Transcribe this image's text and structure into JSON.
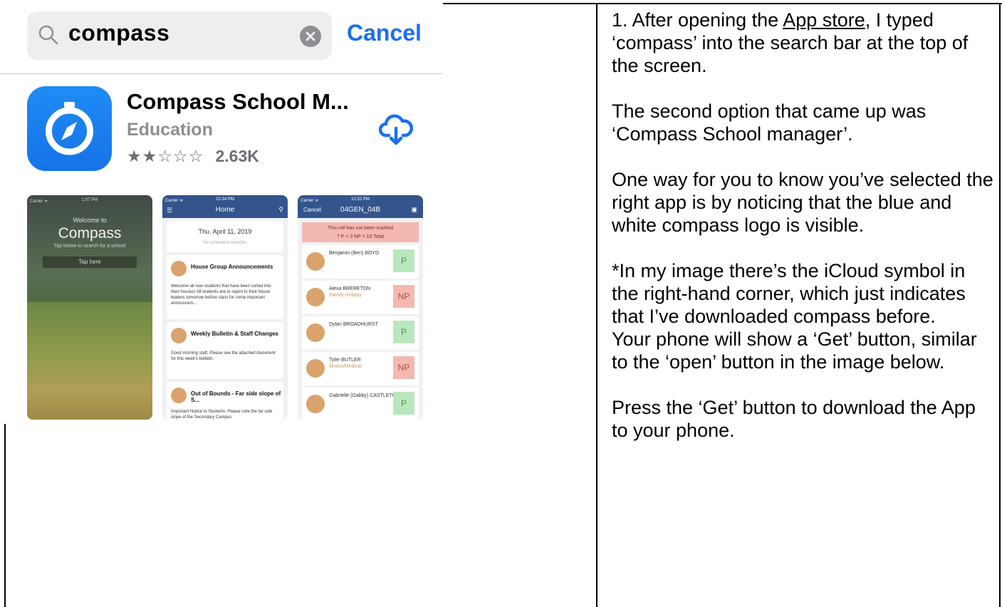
{
  "search": {
    "query": "compass",
    "cancel_label": "Cancel"
  },
  "app": {
    "name": "Compass School M...",
    "category": "Education",
    "stars": "★★☆☆☆",
    "rating_count": "2.63K"
  },
  "screenshots": {
    "s1": {
      "carrier": "Carrier ᯤ",
      "time": "1:07 PM",
      "welcome": "Welcome to",
      "brand": "Compass",
      "sub": "Tap below to search for a school",
      "tap": "Tap here"
    },
    "s2": {
      "carrier": "Carrier ᯤ",
      "time": "12:34 PM",
      "title": "Home",
      "date": "Thu. April 11, 2019",
      "no_activities": "No scheduled activities",
      "cards": [
        {
          "title": "House Group Announcements",
          "body": "Welcome all new students that have been sorted into their houses! All students are to report to their house leaders tomorrow before class for some important announcem..."
        },
        {
          "title": "Weekly Bulletin & Staff Changes",
          "body": "Good morning staff, Please see the attached document for this week's bulletin."
        },
        {
          "title": "Out of Bounds - Far side slope of S...",
          "body": "Important Notice to Students: Please note the far side slope of the Secondary Campus"
        }
      ]
    },
    "s3": {
      "carrier": "Carrier ᯤ",
      "time": "12:52 PM",
      "cancel": "Cancel",
      "title": "04GEN_04B",
      "banner_line1": "This roll has not been marked",
      "banner_line2": "7 P + 3 NP = 10 Total",
      "rows": [
        {
          "name": "Benjamin (Ben) BOYD",
          "sub": "",
          "status": "P"
        },
        {
          "name": "Alexa BRERETON",
          "sub": "Family Holiday",
          "status": "NP"
        },
        {
          "name": "Dylan BROADHURST",
          "sub": "",
          "status": "P"
        },
        {
          "name": "Tyler BUTLER",
          "sub": "Illness/Medical",
          "status": "NP"
        },
        {
          "name": "Gabrielle (Gabby) CASTLETON",
          "sub": "",
          "status": "P"
        }
      ]
    }
  },
  "instructions": {
    "p1_prefix": "1. After opening the ",
    "p1_link": "App store",
    "p1_suffix": ", I typed ‘compass’ into the search bar at the top of the screen.",
    "p2": "The second option that came up was ‘Compass School manager’.",
    "p3": "One way for you to know you’ve selected the right app is by noticing that the blue and white compass logo is visible.",
    "p4": "*In my image there’s the iCloud symbol in the right-hand corner, which just indicates that I’ve downloaded compass before.",
    "p5": "Your phone will show a ‘Get’ button, similar to the ‘open’ button in the image below.",
    "p6": "Press the ‘Get’ button to download the App to your phone."
  },
  "colors": {
    "ios_blue": "#1a6ff2",
    "compass_blue": "#1f8cf5",
    "header_navy": "#34548c"
  }
}
